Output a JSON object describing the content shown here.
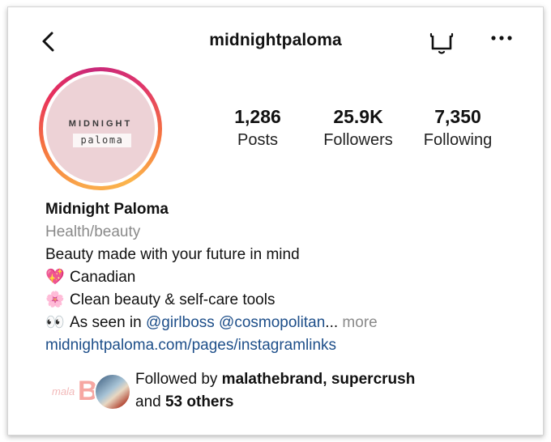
{
  "header": {
    "username": "midnightpaloma",
    "back_icon": "chevron-left-icon",
    "bell_icon": "bell-icon",
    "more_icon": "more-horizontal-icon"
  },
  "avatar": {
    "logo_line1": "MIDNIGHT",
    "logo_line2": "paloma"
  },
  "stats": {
    "posts": {
      "value": "1,286",
      "label": "Posts"
    },
    "followers": {
      "value": "25.9K",
      "label": "Followers"
    },
    "following": {
      "value": "7,350",
      "label": "Following"
    }
  },
  "bio": {
    "name": "Midnight Paloma",
    "category": "Health/beauty",
    "tagline": "Beauty made with your future in mind",
    "line2_emoji": "💖",
    "line2_text": "Canadian",
    "line3_emoji": "🌸",
    "line3_text": "Clean beauty & self-care tools",
    "line4_emoji": "👀",
    "line4_prefix": "As seen in ",
    "mention1": "@girlboss",
    "mention2": "@cosmopolitan",
    "ellipsis": "...",
    "more_label": "more",
    "website": "midnightpaloma.com/pages/instagramlinks"
  },
  "followed_by": {
    "avatar1_text": "mala",
    "avatar1_letter": "B",
    "prefix": "Followed by ",
    "user1": "malathebrand",
    "separator": ", ",
    "user2": "supercrush",
    "and_label": "and ",
    "others": "53 others"
  },
  "colors": {
    "link": "#1d4e89",
    "muted": "#8a8a8a",
    "avatar_bg": "#edd2d6"
  }
}
